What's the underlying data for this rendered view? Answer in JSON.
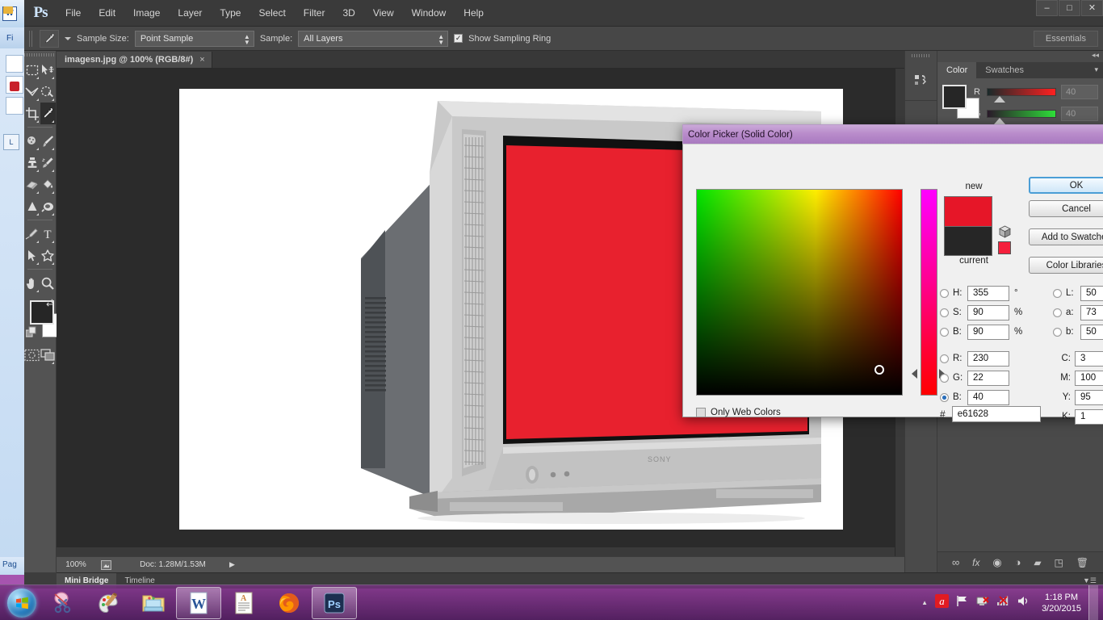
{
  "app": {
    "name": "Ps",
    "title_tooltip": "Adobe Photoshop",
    "workspace": "Essentials"
  },
  "menubar": {
    "items": [
      "File",
      "Edit",
      "Image",
      "Layer",
      "Type",
      "Select",
      "Filter",
      "3D",
      "View",
      "Window",
      "Help"
    ]
  },
  "window_controls": {
    "minimize": "–",
    "maximize": "□",
    "close": "✕"
  },
  "options_bar": {
    "tool_icon": "eyedropper-icon",
    "sample_size_label": "Sample Size:",
    "sample_size_value": "Point Sample",
    "sample_label": "Sample:",
    "sample_value": "All Layers",
    "show_sampling_ring_label": "Show Sampling Ring",
    "show_sampling_ring_checked": true
  },
  "toolbox": {
    "tools": [
      {
        "name": "rectangular-marquee-tool",
        "selected": false
      },
      {
        "name": "move-tool",
        "selected": false
      },
      {
        "name": "lasso-tool",
        "selected": false
      },
      {
        "name": "quick-selection-tool",
        "selected": false
      },
      {
        "name": "crop-tool",
        "selected": false
      },
      {
        "name": "eyedropper-tool",
        "selected": true
      },
      {
        "name": "spot-healing-brush-tool",
        "selected": false
      },
      {
        "name": "brush-tool",
        "selected": false
      },
      {
        "name": "clone-stamp-tool",
        "selected": false
      },
      {
        "name": "history-brush-tool",
        "selected": false
      },
      {
        "name": "eraser-tool",
        "selected": false
      },
      {
        "name": "paint-bucket-tool",
        "selected": false
      },
      {
        "name": "gradient-tool",
        "selected": false
      },
      {
        "name": "dodge-tool",
        "selected": false
      },
      {
        "name": "pen-tool",
        "selected": false
      },
      {
        "name": "horizontal-type-tool",
        "selected": false
      },
      {
        "name": "path-selection-tool",
        "selected": false
      },
      {
        "name": "custom-shape-tool",
        "selected": false
      },
      {
        "name": "hand-tool",
        "selected": false
      },
      {
        "name": "zoom-tool",
        "selected": false
      }
    ],
    "foreground_color": "#262626",
    "background_color": "#ffffff",
    "quick_mask_name": "quick-mask-mode",
    "screen_mode_name": "screen-mode"
  },
  "document": {
    "tab_label": "imagesn.jpg @ 100% (RGB/8#)",
    "close_glyph": "×",
    "canvas_content": "CRT television with solid red screen on white background"
  },
  "status_bar": {
    "zoom": "100%",
    "doc_info": "Doc: 1.28M/1.53M",
    "arrow_glyph": "▶"
  },
  "bottom_panels": {
    "tabs": [
      {
        "label": "Mini Bridge",
        "active": true
      },
      {
        "label": "Timeline",
        "active": false
      }
    ]
  },
  "right_dock": {
    "collapse_glyph": "◂◂",
    "panel_tabs": [
      {
        "label": "Color",
        "active": true
      },
      {
        "label": "Swatches",
        "active": false
      }
    ],
    "panel_menu_glyph": "▾",
    "color_panel": {
      "channels": [
        {
          "label": "R",
          "value": "40"
        },
        {
          "label": "G",
          "value": "40"
        }
      ],
      "foreground": "#262626",
      "background": "#ffffff"
    },
    "layer_buttons": [
      {
        "name": "link-layers-icon",
        "glyph": "∞"
      },
      {
        "name": "layer-style-fx-icon",
        "glyph": "fx"
      },
      {
        "name": "layer-mask-icon",
        "glyph": "◉"
      },
      {
        "name": "adjustment-layer-icon",
        "glyph": "◑"
      },
      {
        "name": "new-group-icon",
        "glyph": "▰"
      },
      {
        "name": "new-layer-icon",
        "glyph": "◳"
      },
      {
        "name": "delete-layer-icon",
        "glyph": "🗑"
      }
    ]
  },
  "color_picker": {
    "title": "Color Picker (Solid Color)",
    "new_label": "new",
    "current_label": "current",
    "new_color": "#e61628",
    "current_color": "#262626",
    "out_of_gamut_swatch": "#f5203c",
    "buttons": [
      {
        "label": "OK",
        "primary": true
      },
      {
        "label": "Cancel",
        "primary": false
      },
      {
        "label": "Add to Swatches",
        "primary": false
      },
      {
        "label": "Color Libraries",
        "primary": false
      }
    ],
    "only_web_colors_label": "Only Web Colors",
    "only_web_colors_checked": false,
    "hsb": [
      {
        "label": "H:",
        "value": "355",
        "unit": "°",
        "selected": false
      },
      {
        "label": "S:",
        "value": "90",
        "unit": "%",
        "selected": false
      },
      {
        "label": "B:",
        "value": "90",
        "unit": "%",
        "selected": false
      }
    ],
    "rgb": [
      {
        "label": "R:",
        "value": "230",
        "unit": "",
        "selected": false
      },
      {
        "label": "G:",
        "value": "22",
        "unit": "",
        "selected": false
      },
      {
        "label": "B:",
        "value": "40",
        "unit": "",
        "selected": true
      }
    ],
    "lab": [
      {
        "label": "L:",
        "value": "50",
        "selected": false
      },
      {
        "label": "a:",
        "value": "73",
        "selected": false
      },
      {
        "label": "b:",
        "value": "50",
        "selected": false
      }
    ],
    "cmyk": [
      {
        "label": "C:",
        "value": "3"
      },
      {
        "label": "M:",
        "value": "100"
      },
      {
        "label": "Y:",
        "value": "95"
      },
      {
        "label": "K:",
        "value": "1"
      }
    ],
    "hex_prefix": "#",
    "hex_value": "e61628"
  },
  "background_word_window": {
    "ribbon_label": "Fi",
    "status_label": "Pag"
  },
  "taskbar": {
    "start_name": "start-orb",
    "items": [
      {
        "name": "snipping-tool-icon",
        "active": false
      },
      {
        "name": "paint-icon",
        "active": false
      },
      {
        "name": "windows-explorer-icon",
        "active": false
      },
      {
        "name": "microsoft-word-icon",
        "active": true,
        "glyph": "W"
      },
      {
        "name": "wordpad-icon",
        "active": false,
        "glyph": "A"
      },
      {
        "name": "firefox-icon",
        "active": false
      },
      {
        "name": "photoshop-icon",
        "active": true,
        "glyph": "Ps"
      }
    ],
    "tray": [
      {
        "name": "show-hidden-icons-icon",
        "glyph": "▲"
      },
      {
        "name": "avira-antivirus-icon",
        "glyph": "a"
      },
      {
        "name": "action-center-flag-icon",
        "glyph": "⚑"
      },
      {
        "name": "network-issue-icon",
        "glyph": "⚠"
      },
      {
        "name": "network-signal-icon",
        "glyph": "◢"
      },
      {
        "name": "volume-icon",
        "glyph": "🔊"
      }
    ],
    "clock_time": "1:18 PM",
    "clock_date": "3/20/2015"
  }
}
